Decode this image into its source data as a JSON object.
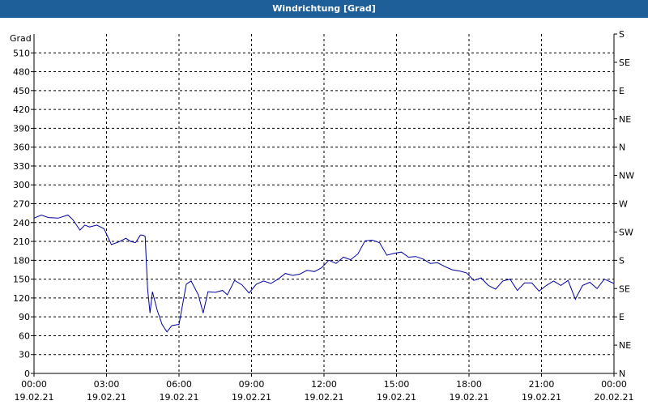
{
  "window": {
    "title": "Windrichtung [Grad]"
  },
  "chart_data": {
    "type": "line",
    "title": "Windrichtung [Grad]",
    "ylabel": "Grad",
    "ylim": [
      0,
      540
    ],
    "yticks": [
      0,
      30,
      60,
      90,
      120,
      150,
      180,
      210,
      240,
      270,
      300,
      330,
      360,
      390,
      420,
      450,
      480,
      510
    ],
    "right_axis_labels": [
      {
        "value": 0,
        "label": "N"
      },
      {
        "value": 45,
        "label": "NE"
      },
      {
        "value": 90,
        "label": "E"
      },
      {
        "value": 135,
        "label": "SE"
      },
      {
        "value": 180,
        "label": "S"
      },
      {
        "value": 225,
        "label": "SW"
      },
      {
        "value": 270,
        "label": "W"
      },
      {
        "value": 315,
        "label": "NW"
      },
      {
        "value": 360,
        "label": "N"
      },
      {
        "value": 405,
        "label": "NE"
      },
      {
        "value": 450,
        "label": "E"
      },
      {
        "value": 495,
        "label": "SE"
      },
      {
        "value": 540,
        "label": "S"
      }
    ],
    "xlim": [
      0,
      24
    ],
    "xticks": [
      {
        "time": "00:00",
        "date": "19.02.21"
      },
      {
        "time": "03:00",
        "date": "19.02.21"
      },
      {
        "time": "06:00",
        "date": "19.02.21"
      },
      {
        "time": "09:00",
        "date": "19.02.21"
      },
      {
        "time": "12:00",
        "date": "19.02.21"
      },
      {
        "time": "15:00",
        "date": "19.02.21"
      },
      {
        "time": "18:00",
        "date": "19.02.21"
      },
      {
        "time": "21:00",
        "date": "19.02.21"
      },
      {
        "time": "00:00",
        "date": "20.02.21"
      }
    ],
    "grid": true,
    "series": [
      {
        "color": "#0000a0",
        "x": [
          0.0,
          0.3,
          0.6,
          1.0,
          1.4,
          1.6,
          1.9,
          2.1,
          2.3,
          2.6,
          2.9,
          3.2,
          3.5,
          3.8,
          4.0,
          4.2,
          4.4,
          4.5,
          4.6,
          4.7,
          4.8,
          4.9,
          5.1,
          5.3,
          5.5,
          5.7,
          6.0,
          6.3,
          6.5,
          6.8,
          7.0,
          7.2,
          7.5,
          7.8,
          8.0,
          8.3,
          8.6,
          8.9,
          9.2,
          9.5,
          9.8,
          10.1,
          10.4,
          10.7,
          11.0,
          11.3,
          11.6,
          11.9,
          12.2,
          12.5,
          12.8,
          13.1,
          13.4,
          13.7,
          14.0,
          14.3,
          14.6,
          14.9,
          15.2,
          15.5,
          15.8,
          16.1,
          16.4,
          16.7,
          17.0,
          17.3,
          17.6,
          17.9,
          18.2,
          18.5,
          18.8,
          19.1,
          19.4,
          19.7,
          20.0,
          20.3,
          20.6,
          20.9,
          21.2,
          21.5,
          21.8,
          22.1,
          22.4,
          22.7,
          23.0,
          23.3,
          23.6,
          24.0
        ],
        "y": [
          247,
          252,
          248,
          247,
          252,
          245,
          228,
          236,
          233,
          236,
          230,
          205,
          209,
          215,
          210,
          208,
          220,
          220,
          218,
          135,
          96,
          130,
          100,
          78,
          66,
          76,
          78,
          142,
          147,
          125,
          96,
          130,
          129,
          132,
          125,
          148,
          141,
          128,
          142,
          147,
          143,
          150,
          159,
          156,
          158,
          164,
          162,
          168,
          180,
          175,
          185,
          181,
          190,
          211,
          212,
          208,
          188,
          191,
          193,
          185,
          186,
          182,
          175,
          176,
          170,
          165,
          163,
          160,
          148,
          152,
          140,
          134,
          147,
          150,
          132,
          144,
          144,
          131,
          140,
          147,
          140,
          148,
          118,
          140,
          145,
          135,
          150,
          143
        ]
      }
    ]
  }
}
